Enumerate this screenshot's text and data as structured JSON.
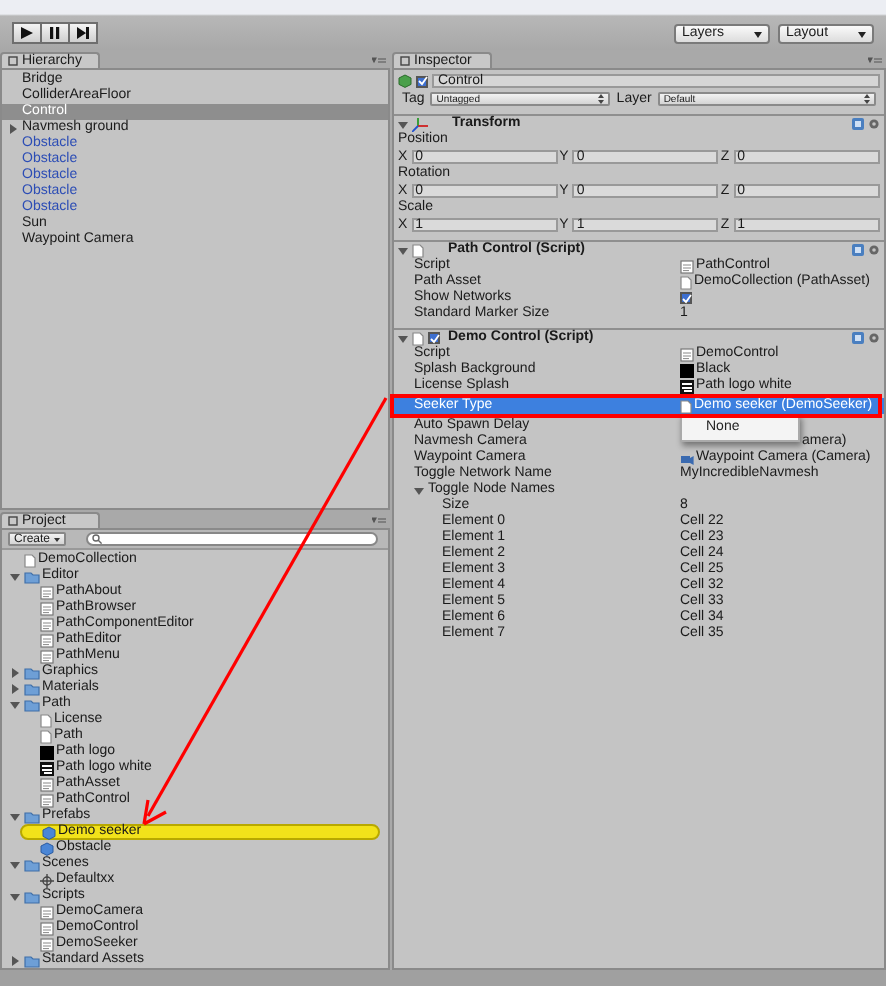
{
  "toolbar": {
    "play_buttons": [
      {
        "kind": "play"
      },
      {
        "kind": "pause"
      },
      {
        "kind": "step"
      }
    ],
    "dropdowns": [
      "Layers",
      "Layout"
    ]
  },
  "hierarchy": {
    "title": "Hierarchy",
    "items": [
      {
        "label": "Bridge",
        "kind": "object",
        "selected": false
      },
      {
        "label": "ColliderAreaFloor",
        "kind": "object",
        "selected": false
      },
      {
        "label": "Control",
        "kind": "object",
        "selected": true
      },
      {
        "label": "Navmesh ground",
        "kind": "group",
        "selected": false
      },
      {
        "label": "Obstacle",
        "kind": "prefab",
        "selected": false
      },
      {
        "label": "Obstacle",
        "kind": "prefab",
        "selected": false
      },
      {
        "label": "Obstacle",
        "kind": "prefab",
        "selected": false
      },
      {
        "label": "Obstacle",
        "kind": "prefab",
        "selected": false
      },
      {
        "label": "Obstacle",
        "kind": "prefab",
        "selected": false
      },
      {
        "label": "Sun",
        "kind": "object",
        "selected": false
      },
      {
        "label": "Waypoint Camera",
        "kind": "object",
        "selected": false
      }
    ]
  },
  "project": {
    "title": "Project",
    "create": "Create",
    "items": [
      {
        "label": "DemoCollection",
        "kind": "asset",
        "selected": false
      },
      {
        "label": "Editor",
        "kind": "folder",
        "expanded": true,
        "selected": false,
        "children": [
          {
            "label": "PathAbout",
            "kind": "script",
            "selected": false
          },
          {
            "label": "PathBrowser",
            "kind": "script",
            "selected": false
          },
          {
            "label": "PathComponentEditor",
            "kind": "script",
            "selected": false
          },
          {
            "label": "PathEditor",
            "kind": "script",
            "selected": false
          },
          {
            "label": "PathMenu",
            "kind": "script",
            "selected": false
          }
        ]
      },
      {
        "label": "Graphics",
        "kind": "folder",
        "expanded": false,
        "selected": false
      },
      {
        "label": "Materials",
        "kind": "folder",
        "expanded": false,
        "selected": false
      },
      {
        "label": "Path",
        "kind": "folder",
        "expanded": true,
        "selected": false,
        "children": [
          {
            "label": "License",
            "kind": "text",
            "selected": false
          },
          {
            "label": "Path",
            "kind": "asset",
            "selected": false
          },
          {
            "label": "Path logo",
            "kind": "texture",
            "selected": false
          },
          {
            "label": "Path logo white",
            "kind": "texture_white",
            "selected": false
          },
          {
            "label": "PathAsset",
            "kind": "script",
            "selected": false
          },
          {
            "label": "PathControl",
            "kind": "script",
            "selected": false
          }
        ]
      },
      {
        "label": "Prefabs",
        "kind": "folder",
        "expanded": true,
        "selected": false,
        "children": [
          {
            "label": "Demo seeker",
            "kind": "prefab",
            "selected": true
          },
          {
            "label": "Obstacle",
            "kind": "prefab",
            "selected": false
          }
        ]
      },
      {
        "label": "Scenes",
        "kind": "folder",
        "expanded": true,
        "selected": false,
        "children": [
          {
            "label": "Defaultxx",
            "kind": "scene",
            "selected": false
          }
        ]
      },
      {
        "label": "Scripts",
        "kind": "folder",
        "expanded": true,
        "selected": false,
        "children": [
          {
            "label": "DemoCamera",
            "kind": "script",
            "selected": false
          },
          {
            "label": "DemoControl",
            "kind": "script",
            "selected": false
          },
          {
            "label": "DemoSeeker",
            "kind": "script",
            "selected": false
          }
        ]
      },
      {
        "label": "Standard Assets",
        "kind": "folder",
        "expanded": false,
        "selected": false
      }
    ]
  },
  "inspector": {
    "title": "Inspector",
    "object": {
      "active": true,
      "name": "Control"
    },
    "tag": {
      "label": "Tag",
      "value": "Untagged"
    },
    "layer": {
      "label": "Layer",
      "value": "Default"
    },
    "components": [
      {
        "kind": "transform",
        "title": "Transform",
        "expanded": true,
        "vectors": [
          {
            "label": "Position",
            "values": [
              {
                "axis": "X",
                "value": "0"
              },
              {
                "axis": "Y",
                "value": "0"
              },
              {
                "axis": "Z",
                "value": "0"
              }
            ]
          },
          {
            "label": "Rotation",
            "values": [
              {
                "axis": "X",
                "value": "0"
              },
              {
                "axis": "Y",
                "value": "0"
              },
              {
                "axis": "Z",
                "value": "0"
              }
            ]
          },
          {
            "label": "Scale",
            "values": [
              {
                "axis": "X",
                "value": "1"
              },
              {
                "axis": "Y",
                "value": "1"
              },
              {
                "axis": "Z",
                "value": "1"
              }
            ]
          }
        ]
      },
      {
        "kind": "script",
        "title": "Path Control (Script)",
        "expanded": true,
        "rows": [
          {
            "label": "Script",
            "kind": "script",
            "value": "PathControl",
            "selected": false
          },
          {
            "label": "Path Asset",
            "kind": "asset",
            "value": "DemoCollection (PathAsset)",
            "selected": false
          },
          {
            "label": "Show Networks",
            "kind": "toggle",
            "checked": true,
            "selected": false
          },
          {
            "label": "Standard Marker Size",
            "kind": "text",
            "value": "1",
            "selected": false
          }
        ]
      },
      {
        "kind": "script",
        "title": "Demo Control (Script)",
        "expanded": true,
        "enabled": true,
        "rows": [
          {
            "label": "Script",
            "kind": "script",
            "value": "DemoControl",
            "selected": false
          },
          {
            "label": "Splash Background",
            "kind": "texture",
            "value": "Black",
            "selected": false
          },
          {
            "label": "License Splash",
            "kind": "texture_white",
            "value": "Path logo white",
            "selected": false
          },
          {
            "label": "Seeker Type",
            "kind": "prefab",
            "value": "Demo seeker (DemoSeeker)",
            "selected": true
          },
          {
            "label": "Auto Spawn Delay",
            "kind": "text",
            "selected": false
          },
          {
            "label": "Navmesh Camera",
            "kind": "camera_covered",
            "value": "amera)",
            "selected": false
          },
          {
            "label": "Waypoint Camera",
            "kind": "camera",
            "value": "Waypoint Camera (Camera)",
            "selected": false
          },
          {
            "label": "Toggle Network Name",
            "kind": "text",
            "value": "MyIncredibleNavmesh",
            "selected": false
          },
          {
            "label": "Toggle Node Names",
            "kind": "array",
            "expanded": true,
            "selected": false,
            "children": [
              {
                "label": "Size",
                "value": "8"
              },
              {
                "label": "Element 0",
                "value": "Cell 22"
              },
              {
                "label": "Element 1",
                "value": "Cell 23"
              },
              {
                "label": "Element 2",
                "value": "Cell 24"
              },
              {
                "label": "Element 3",
                "value": "Cell 25"
              },
              {
                "label": "Element 4",
                "value": "Cell 32"
              },
              {
                "label": "Element 5",
                "value": "Cell 33"
              },
              {
                "label": "Element 6",
                "value": "Cell 34"
              },
              {
                "label": "Element 7",
                "value": "Cell 35"
              }
            ]
          }
        ]
      }
    ],
    "popup": {
      "items": [
        "None"
      ]
    }
  }
}
